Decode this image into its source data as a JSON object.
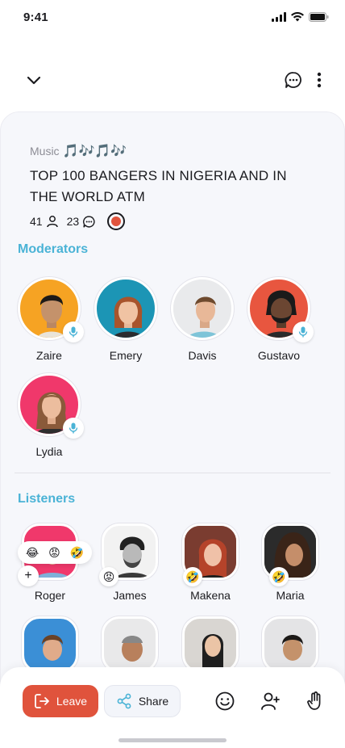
{
  "status_bar": {
    "time": "9:41"
  },
  "room": {
    "category": "Music",
    "category_emoji": "🎵🎶🎵🎶",
    "title": "TOP 100 BANGERS IN NIGERIA AND IN THE WORLD ATM",
    "listeners_count": "41",
    "comments_count": "23"
  },
  "moderators": {
    "heading": "Moderators",
    "people": [
      {
        "name": "Zaire",
        "bg": "#f6a323",
        "mic": true
      },
      {
        "name": "Emery",
        "bg": "#1c95b5",
        "mic": false
      },
      {
        "name": "Davis",
        "bg": "#ebedf0",
        "mic": false
      },
      {
        "name": "Gustavo",
        "bg": "#e8563f",
        "mic": true
      },
      {
        "name": "Lydia",
        "bg": "#f0386b",
        "mic": true
      }
    ]
  },
  "listeners": {
    "heading": "Listeners",
    "reaction_picker": [
      "😂",
      "😡",
      "🤣"
    ],
    "add_reaction": "+",
    "people": [
      {
        "name": "Roger",
        "reaction": ""
      },
      {
        "name": "James",
        "reaction": "😡"
      },
      {
        "name": "Makena",
        "reaction": "🤣"
      },
      {
        "name": "Maria",
        "reaction": "🤣"
      }
    ]
  },
  "bottom_bar": {
    "leave_label": "Leave",
    "share_label": "Share"
  },
  "colors": {
    "accent": "#4ab3d6",
    "leave": "#e0533c",
    "record": "#e0533c"
  }
}
